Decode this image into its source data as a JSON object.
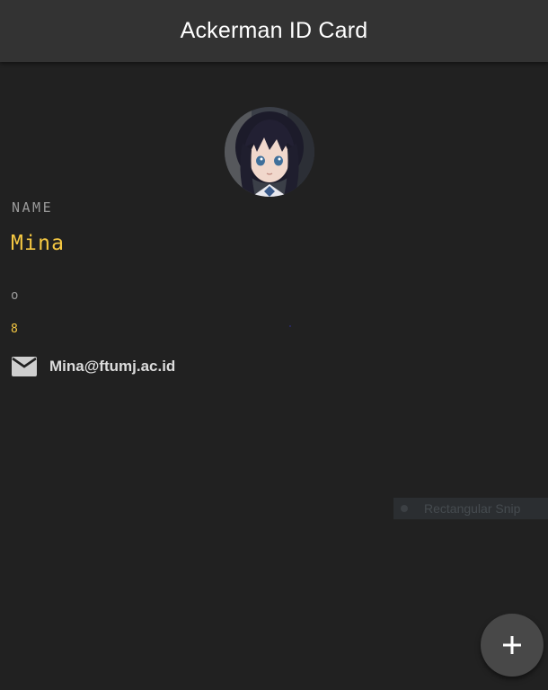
{
  "app_bar": {
    "title": "Ackerman ID Card"
  },
  "profile": {
    "avatar_icon": "anime-girl-portrait",
    "name_label": "NAME",
    "name_value": "Mina",
    "second_label": "o",
    "second_value": "8",
    "email_icon": "mail-icon",
    "email": "Mina@ftumj.ac.id"
  },
  "overlay": {
    "snip_label": "Rectangular Snip"
  },
  "fab": {
    "icon": "plus-icon"
  },
  "colors": {
    "background": "#212121",
    "app_bar": "#333333",
    "accent": "#f5c842",
    "fab": "#484848"
  }
}
